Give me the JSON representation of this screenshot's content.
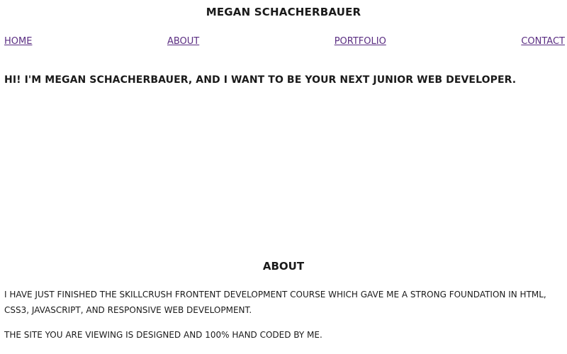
{
  "site": {
    "title": "MEGAN SCHACHERBAUER",
    "link_color": "#5a2d82"
  },
  "nav": {
    "items": [
      "HOME",
      "ABOUT",
      "PORTFOLIO",
      "CONTACT"
    ]
  },
  "hero": {
    "text": "HI! I'M MEGAN SCHACHERBAUER, AND I WANT TO BE YOUR NEXT JUNIOR WEB DEVELOPER."
  },
  "about": {
    "heading": "ABOUT",
    "paragraphs": [
      "I HAVE JUST FINISHED THE SKILLCRUSH FRONTENT DEVELOPMENT COURSE WHICH GAVE ME A STRONG FOUNDATION IN HTML, CSS3, JAVASCRIPT, AND RESPONSIVE WEB DEVELOPMENT.",
      "THE SITE YOU ARE VIEWING IS DESIGNED AND 100% HAND CODED BY ME."
    ]
  }
}
